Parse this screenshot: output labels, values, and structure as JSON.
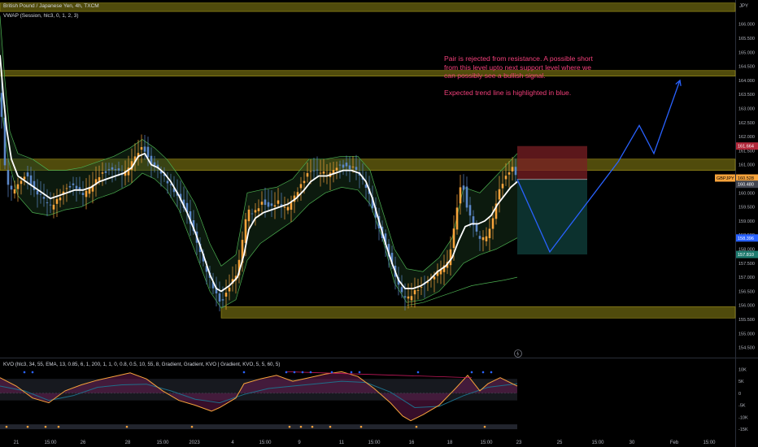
{
  "header": {
    "symbol_line": "British Pound / Japanese Yen, 4h, TXCM",
    "vwap_line": "VWAP (Session, hlc3, 0, 1, 2, 3)",
    "kvo_line": "KVO (hlc3, 34, 55, EMA, 13, 0.85, 6, 1, 200, 1, 1, 0, 0.8, 0.5, 10, 55, 8, Gradient, Gradient, KVO | Gradient, KVO, 5, 5, 60, 5)"
  },
  "annotation": {
    "text": "Pair is rejected from resistance. A possible short from this level upto next support level where we can possibly see a bullish signal.\n\nExpected trend line is highlighted in blue."
  },
  "colors": {
    "background": "#000000",
    "zone": "#6b6410",
    "candle_orange": "#f7a33b",
    "candle_blue": "#5b87c7",
    "vwap": "#ffffff",
    "band": "#4caf50",
    "projection": "#2962ff",
    "stop_zone": "#7a1f24",
    "target_zone": "#0e3a36",
    "annotation": "#f23f7a"
  },
  "chart_data": {
    "type": "candlestick",
    "title": "British Pound / Japanese Yen, 4h, TXCM",
    "ylabel": "JPY",
    "ylim": [
      154.2,
      166.8
    ],
    "y_ticks": [
      "166.000",
      "165.500",
      "165.000",
      "164.500",
      "164.000",
      "163.500",
      "163.000",
      "162.500",
      "162.000",
      "161.500",
      "161.000",
      "160.500",
      "160.000",
      "159.500",
      "159.000",
      "158.500",
      "158.000",
      "157.500",
      "157.000",
      "156.500",
      "156.000",
      "155.500",
      "155.000",
      "154.500"
    ],
    "x_ticks": [
      "21",
      "15:00",
      "26",
      "28",
      "15:00",
      "2023",
      "4",
      "15:00",
      "9",
      "11",
      "15:00",
      "16",
      "18",
      "15:00",
      "23",
      "25",
      "15:00",
      "30",
      "Feb",
      "15:00"
    ],
    "price_labels": [
      {
        "label": "161.664",
        "value": 161.664,
        "kind": "stop"
      },
      {
        "label": "GBPJPY",
        "value": 160.528,
        "kind": "symbol"
      },
      {
        "label": "160.528",
        "value": 160.528,
        "kind": "last"
      },
      {
        "label": "160.480",
        "value": 160.48,
        "kind": "entry"
      },
      {
        "label": "158.396",
        "value": 158.396,
        "kind": "level"
      },
      {
        "label": "157.810",
        "value": 157.81,
        "kind": "target"
      }
    ],
    "zones": [
      {
        "name": "resistance-top",
        "from": 166.75,
        "to": 166.45
      },
      {
        "name": "resistance-upper",
        "from": 164.35,
        "to": 164.15
      },
      {
        "name": "resistance",
        "from": 161.2,
        "to": 160.8
      },
      {
        "name": "support",
        "from": 155.95,
        "to": 155.55
      }
    ],
    "price_path": [
      [
        0,
        163.6
      ],
      [
        6,
        161.0
      ],
      [
        12,
        160.1
      ],
      [
        22,
        160.3
      ],
      [
        32,
        160.6
      ],
      [
        42,
        160.0
      ],
      [
        52,
        159.9
      ],
      [
        62,
        159.6
      ],
      [
        72,
        159.8
      ],
      [
        82,
        160.1
      ],
      [
        92,
        160.2
      ],
      [
        102,
        160.0
      ],
      [
        112,
        160.3
      ],
      [
        122,
        160.6
      ],
      [
        132,
        160.7
      ],
      [
        142,
        160.8
      ],
      [
        152,
        160.7
      ],
      [
        160,
        161.1
      ],
      [
        168,
        161.4
      ],
      [
        176,
        161.6
      ],
      [
        184,
        161.0
      ],
      [
        192,
        160.9
      ],
      [
        200,
        160.7
      ],
      [
        210,
        160.3
      ],
      [
        220,
        159.8
      ],
      [
        230,
        159.2
      ],
      [
        240,
        158.4
      ],
      [
        250,
        157.6
      ],
      [
        258,
        157.0
      ],
      [
        266,
        156.4
      ],
      [
        272,
        156.0
      ],
      [
        282,
        156.6
      ],
      [
        292,
        157.2
      ],
      [
        298,
        158.4
      ],
      [
        304,
        159.5
      ],
      [
        312,
        159.3
      ],
      [
        322,
        159.6
      ],
      [
        332,
        159.4
      ],
      [
        342,
        159.7
      ],
      [
        352,
        159.5
      ],
      [
        362,
        159.9
      ],
      [
        372,
        160.3
      ],
      [
        380,
        160.7
      ],
      [
        388,
        160.8
      ],
      [
        396,
        160.8
      ],
      [
        404,
        160.7
      ],
      [
        412,
        160.9
      ],
      [
        420,
        160.9
      ],
      [
        428,
        160.8
      ],
      [
        436,
        160.9
      ],
      [
        444,
        160.6
      ],
      [
        452,
        160.2
      ],
      [
        460,
        159.3
      ],
      [
        468,
        158.5
      ],
      [
        476,
        157.9
      ],
      [
        484,
        157.2
      ],
      [
        492,
        156.6
      ],
      [
        500,
        156.3
      ],
      [
        510,
        156.5
      ],
      [
        520,
        156.6
      ],
      [
        530,
        156.9
      ],
      [
        540,
        157.3
      ],
      [
        550,
        157.6
      ],
      [
        556,
        158.3
      ],
      [
        562,
        159.5
      ],
      [
        568,
        160.4
      ],
      [
        574,
        159.4
      ],
      [
        580,
        159.0
      ],
      [
        586,
        158.6
      ],
      [
        592,
        158.4
      ],
      [
        600,
        158.6
      ],
      [
        606,
        159.1
      ],
      [
        612,
        159.9
      ],
      [
        618,
        160.3
      ],
      [
        624,
        160.6
      ],
      [
        630,
        160.9
      ],
      [
        636,
        160.5
      ]
    ],
    "vwap_path": [
      [
        0,
        164.9
      ],
      [
        4,
        163.5
      ],
      [
        8,
        162.3
      ],
      [
        14,
        161.2
      ],
      [
        22,
        160.6
      ],
      [
        32,
        160.4
      ],
      [
        42,
        160.2
      ],
      [
        52,
        160.0
      ],
      [
        62,
        159.8
      ],
      [
        72,
        159.9
      ],
      [
        82,
        160.0
      ],
      [
        92,
        160.1
      ],
      [
        102,
        160.1
      ],
      [
        112,
        160.2
      ],
      [
        122,
        160.4
      ],
      [
        132,
        160.5
      ],
      [
        142,
        160.6
      ],
      [
        152,
        160.7
      ],
      [
        162,
        160.9
      ],
      [
        170,
        161.3
      ],
      [
        178,
        161.4
      ],
      [
        186,
        161.0
      ],
      [
        194,
        160.9
      ],
      [
        202,
        160.7
      ],
      [
        210,
        160.4
      ],
      [
        220,
        159.9
      ],
      [
        230,
        159.3
      ],
      [
        240,
        158.6
      ],
      [
        250,
        157.8
      ],
      [
        258,
        157.1
      ],
      [
        266,
        156.6
      ],
      [
        272,
        156.5
      ],
      [
        282,
        156.7
      ],
      [
        292,
        157.0
      ],
      [
        300,
        157.8
      ],
      [
        306,
        158.7
      ],
      [
        314,
        159.1
      ],
      [
        324,
        159.3
      ],
      [
        334,
        159.4
      ],
      [
        344,
        159.5
      ],
      [
        354,
        159.6
      ],
      [
        364,
        159.8
      ],
      [
        374,
        160.1
      ],
      [
        382,
        160.4
      ],
      [
        392,
        160.6
      ],
      [
        402,
        160.6
      ],
      [
        412,
        160.7
      ],
      [
        422,
        160.8
      ],
      [
        432,
        160.8
      ],
      [
        442,
        160.7
      ],
      [
        450,
        160.4
      ],
      [
        458,
        159.8
      ],
      [
        466,
        159.0
      ],
      [
        474,
        158.2
      ],
      [
        482,
        157.5
      ],
      [
        490,
        156.9
      ],
      [
        498,
        156.6
      ],
      [
        508,
        156.6
      ],
      [
        518,
        156.7
      ],
      [
        528,
        156.9
      ],
      [
        538,
        157.2
      ],
      [
        548,
        157.4
      ],
      [
        556,
        157.7
      ],
      [
        564,
        158.3
      ],
      [
        572,
        158.8
      ],
      [
        580,
        158.9
      ],
      [
        588,
        158.9
      ],
      [
        596,
        159.0
      ],
      [
        604,
        159.2
      ],
      [
        612,
        159.6
      ],
      [
        620,
        159.9
      ],
      [
        628,
        160.2
      ],
      [
        636,
        160.4
      ]
    ],
    "band_upper_path": [
      [
        0,
        166.3
      ],
      [
        6,
        164.0
      ],
      [
        12,
        162.2
      ],
      [
        22,
        161.4
      ],
      [
        40,
        161.2
      ],
      [
        60,
        160.8
      ],
      [
        80,
        160.8
      ],
      [
        100,
        160.9
      ],
      [
        120,
        161.1
      ],
      [
        140,
        161.3
      ],
      [
        160,
        161.6
      ],
      [
        175,
        161.9
      ],
      [
        190,
        161.6
      ],
      [
        205,
        161.2
      ],
      [
        220,
        160.6
      ],
      [
        240,
        159.6
      ],
      [
        258,
        158.2
      ],
      [
        272,
        157.4
      ],
      [
        290,
        157.8
      ],
      [
        304,
        160.0
      ],
      [
        320,
        160.1
      ],
      [
        340,
        160.2
      ],
      [
        360,
        160.5
      ],
      [
        380,
        161.2
      ],
      [
        400,
        161.2
      ],
      [
        420,
        161.3
      ],
      [
        440,
        161.3
      ],
      [
        455,
        160.8
      ],
      [
        470,
        159.4
      ],
      [
        485,
        158.0
      ],
      [
        500,
        157.3
      ],
      [
        520,
        157.2
      ],
      [
        540,
        157.7
      ],
      [
        556,
        158.4
      ],
      [
        570,
        160.2
      ],
      [
        590,
        160.0
      ],
      [
        610,
        160.6
      ],
      [
        636,
        161.4
      ]
    ],
    "band_lower_path": [
      [
        0,
        163.4
      ],
      [
        10,
        161.2
      ],
      [
        22,
        159.9
      ],
      [
        40,
        159.3
      ],
      [
        60,
        159.2
      ],
      [
        80,
        159.4
      ],
      [
        100,
        159.5
      ],
      [
        120,
        159.8
      ],
      [
        140,
        160.0
      ],
      [
        160,
        160.3
      ],
      [
        175,
        160.7
      ],
      [
        190,
        160.5
      ],
      [
        205,
        160.1
      ],
      [
        220,
        159.4
      ],
      [
        240,
        157.9
      ],
      [
        258,
        156.5
      ],
      [
        272,
        155.9
      ],
      [
        290,
        156.2
      ],
      [
        304,
        157.6
      ],
      [
        320,
        158.2
      ],
      [
        340,
        158.6
      ],
      [
        360,
        159.0
      ],
      [
        380,
        159.6
      ],
      [
        400,
        160.0
      ],
      [
        420,
        160.2
      ],
      [
        440,
        160.1
      ],
      [
        455,
        159.6
      ],
      [
        470,
        158.4
      ],
      [
        485,
        156.8
      ],
      [
        500,
        156.1
      ],
      [
        520,
        156.2
      ],
      [
        540,
        156.5
      ],
      [
        556,
        157.0
      ],
      [
        570,
        157.5
      ],
      [
        590,
        157.8
      ],
      [
        610,
        158.0
      ],
      [
        636,
        158.4
      ]
    ],
    "band_outer_path": [
      [
        500,
        156.0
      ],
      [
        520,
        156.1
      ],
      [
        540,
        156.3
      ],
      [
        560,
        156.5
      ],
      [
        580,
        156.7
      ],
      [
        600,
        156.8
      ],
      [
        620,
        156.9
      ],
      [
        636,
        157.0
      ]
    ],
    "projection_path": [
      [
        636,
        160.48
      ],
      [
        676,
        157.9
      ],
      [
        760,
        161.1
      ],
      [
        786,
        162.4
      ],
      [
        804,
        161.4
      ],
      [
        836,
        164.0
      ]
    ],
    "position": {
      "x_start": 636,
      "x_end": 722,
      "stop": 161.664,
      "entry": 160.48,
      "target": 157.81
    },
    "kvo": {
      "ylim": [
        -15000,
        11500
      ],
      "y_ticks": [
        "10K",
        "5K",
        "0",
        "-5K",
        "-10K",
        "-15K"
      ],
      "y_tick_values": [
        10000,
        5000,
        0,
        -5000,
        -10000,
        -15000
      ],
      "series": [
        {
          "name": "KVO",
          "points": [
            [
              0,
              6500
            ],
            [
              20,
              3000
            ],
            [
              40,
              -2000
            ],
            [
              60,
              -4000
            ],
            [
              80,
              1000
            ],
            [
              100,
              3500
            ],
            [
              120,
              5500
            ],
            [
              140,
              7000
            ],
            [
              160,
              8500
            ],
            [
              180,
              6000
            ],
            [
              200,
              1000
            ],
            [
              220,
              -3000
            ],
            [
              240,
              -5000
            ],
            [
              260,
              -7500
            ],
            [
              270,
              -6000
            ],
            [
              290,
              -2000
            ],
            [
              300,
              4000
            ],
            [
              320,
              6000
            ],
            [
              340,
              7500
            ],
            [
              360,
              5000
            ],
            [
              380,
              6500
            ],
            [
              400,
              8000
            ],
            [
              420,
              9000
            ],
            [
              440,
              7000
            ],
            [
              460,
              2000
            ],
            [
              480,
              -4000
            ],
            [
              495,
              -9500
            ],
            [
              505,
              -11500
            ],
            [
              520,
              -9000
            ],
            [
              540,
              -5000
            ],
            [
              560,
              2000
            ],
            [
              575,
              7500
            ],
            [
              590,
              1000
            ],
            [
              600,
              4000
            ],
            [
              615,
              6500
            ],
            [
              636,
              3000
            ]
          ]
        },
        {
          "name": "Signal",
          "points": [
            [
              0,
              3000
            ],
            [
              30,
              1000
            ],
            [
              60,
              -3000
            ],
            [
              90,
              -1000
            ],
            [
              120,
              2500
            ],
            [
              150,
              3500
            ],
            [
              180,
              3800
            ],
            [
              210,
              1000
            ],
            [
              240,
              -2500
            ],
            [
              270,
              -4000
            ],
            [
              300,
              -500
            ],
            [
              330,
              2000
            ],
            [
              360,
              3000
            ],
            [
              390,
              4000
            ],
            [
              420,
              5000
            ],
            [
              450,
              4500
            ],
            [
              480,
              500
            ],
            [
              510,
              -6000
            ],
            [
              540,
              -5500
            ],
            [
              570,
              -1000
            ],
            [
              600,
              2500
            ],
            [
              636,
              4000
            ]
          ]
        }
      ],
      "top_markers_x": [
        30,
        40,
        300,
        352,
        362,
        372,
        382,
        408,
        432,
        442,
        514,
        580,
        594,
        604
      ],
      "bottom_markers_x": [
        8,
        34,
        56,
        72,
        156,
        236,
        356,
        370,
        384,
        406,
        444,
        512,
        596
      ]
    }
  }
}
